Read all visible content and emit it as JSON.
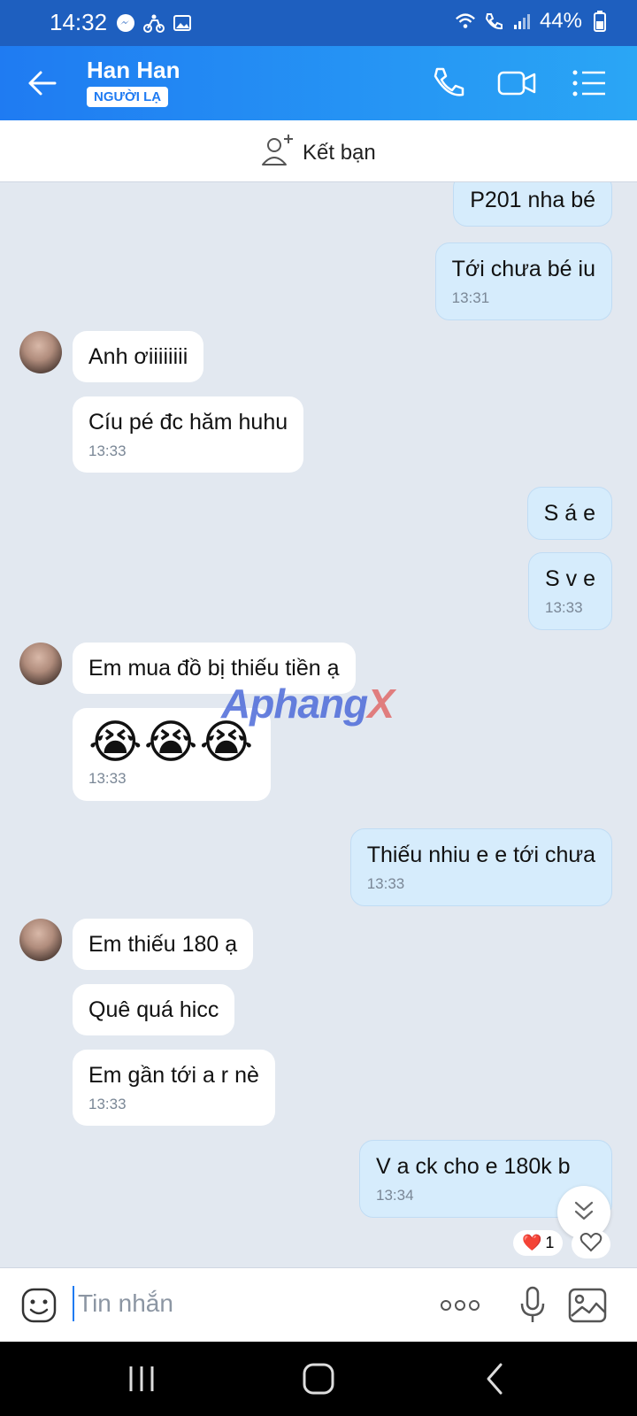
{
  "status": {
    "time": "14:32",
    "battery": "44%"
  },
  "header": {
    "contact_name": "Han Han",
    "badge": "NGƯỜI LẠ"
  },
  "addfriend": {
    "label": "Kết bạn"
  },
  "messages": {
    "m1": "P201 nha bé",
    "m2": "Tới chưa bé iu",
    "m2_time": "13:31",
    "m3": "Anh ơiiiiiiii",
    "m4": "Cíu pé đc hăm huhu",
    "m4_time": "13:33",
    "m5": "S á e",
    "m6": "S v e",
    "m6_time": "13:33",
    "m7": "Em mua đồ bị thiếu tiền ạ",
    "m8": "😭😭😭",
    "m8_time": "13:33",
    "m9": "Thiếu nhiu e e tới chưa",
    "m9_time": "13:33",
    "m10": "Em thiếu 180 ạ",
    "m11": "Quê quá hicc",
    "m12": "Em gần tới a r nè",
    "m12_time": "13:33",
    "m13": "V a ck cho e 180k b",
    "m13_time": "13:34"
  },
  "reaction": {
    "heart": "❤️",
    "count": "1"
  },
  "watermark": {
    "main": "Aphang",
    "x": "X"
  },
  "input": {
    "placeholder": "Tin nhắn"
  },
  "icons": [
    "back-arrow-icon",
    "phone-icon",
    "video-icon",
    "list-icon",
    "add-friend-icon",
    "emoji-icon",
    "more-icon",
    "mic-icon",
    "image-icon",
    "chevron-down-icon",
    "heart-icon"
  ]
}
